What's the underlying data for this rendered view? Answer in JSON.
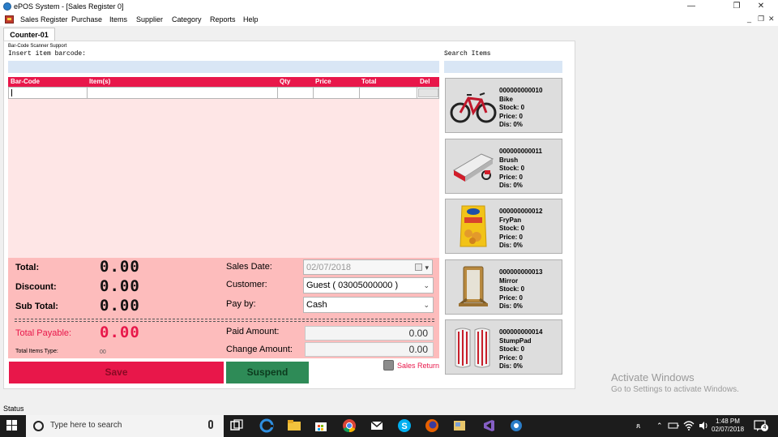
{
  "window": {
    "title": "ePOS System - [Sales Register 0]"
  },
  "window_controls": {
    "minimize": "—",
    "restore": "❐",
    "close": "✕"
  },
  "mdi_controls": {
    "minimize": "_",
    "restore": "❐",
    "close": "✕"
  },
  "menu": [
    "Sales Register",
    "Purchase",
    "Items",
    "Supplier",
    "Category",
    "Reports",
    "Help"
  ],
  "tab": {
    "label": "Counter-01"
  },
  "barcode": {
    "support_label": "Bar-Code Scanner Support",
    "prompt": "Insert item barcode:",
    "value": ""
  },
  "search": {
    "label": "Search Items",
    "value": ""
  },
  "grid": {
    "columns": [
      "Bar-Code",
      "Item(s)",
      "Qty",
      "Price",
      "Total",
      "Del"
    ]
  },
  "summary": {
    "total_label": "Total:",
    "total_value": "0.00",
    "discount_label": "Discount:",
    "discount_value": "0.00",
    "subtotal_label": "Sub Total:",
    "subtotal_value": "0.00",
    "payable_label": "Total Payable:",
    "payable_value": "0.00",
    "items_type_label": "Total Items Type:",
    "items_type_value": "00",
    "sales_date_label": "Sales Date:",
    "sales_date_value": "02/07/2018",
    "customer_label": "Customer:",
    "customer_value": "Guest ( 03005000000 )",
    "payby_label": "Pay by:",
    "payby_value": "Cash",
    "paid_label": "Paid Amount:",
    "paid_value": "0.00",
    "change_label": "Change Amount:",
    "change_value": "0.00"
  },
  "actions": {
    "save": "Save",
    "suspend": "Suspend",
    "sales_return": "Sales Return"
  },
  "items": [
    {
      "code": "000000000010",
      "name": "Bike",
      "stock": "Stock: 0",
      "price": "Price: 0",
      "dis": "Dis: 0%",
      "icon": "bike-image"
    },
    {
      "code": "000000000011",
      "name": "Brush",
      "stock": "Stock: 0",
      "price": "Price: 0",
      "dis": "Dis: 0%",
      "icon": "brush-image"
    },
    {
      "code": "000000000012",
      "name": "FryPan",
      "stock": "Stock: 0",
      "price": "Price: 0",
      "dis": "Dis: 0%",
      "icon": "chips-packet-image"
    },
    {
      "code": "000000000013",
      "name": "Mirror",
      "stock": "Stock: 0",
      "price": "Price: 0",
      "dis": "Dis: 0%",
      "icon": "mirror-image"
    },
    {
      "code": "000000000014",
      "name": "StumpPad",
      "stock": "Stock: 0",
      "price": "Price: 0",
      "dis": "Dis: 0%",
      "icon": "cricket-pad-image"
    }
  ],
  "statusbar": {
    "text": "Status"
  },
  "watermark": {
    "title": "Activate Windows",
    "subtitle": "Go to Settings to activate Windows."
  },
  "taskbar": {
    "search_placeholder": "Type here to search",
    "time": "1:48 PM",
    "date": "02/07/2018",
    "notifications": "4",
    "tray_person": "ጸ",
    "tray_caret": "⌃"
  },
  "colors": {
    "accent": "#e8174a",
    "grid_bg": "#fee6e6",
    "summary_bg": "#fdbcbc",
    "suspend": "#2e8b57"
  }
}
